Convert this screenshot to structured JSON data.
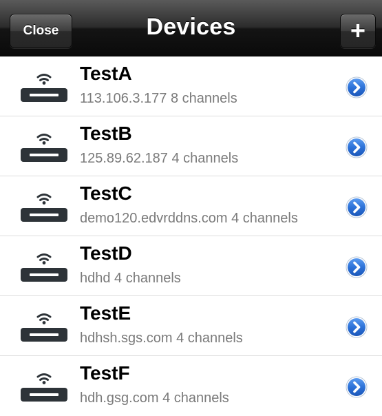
{
  "navbar": {
    "title": "Devices",
    "close_label": "Close",
    "add_label": "+"
  },
  "devices": [
    {
      "name": "TestA",
      "detail": "113.106.3.177 8 channels"
    },
    {
      "name": "TestB",
      "detail": "125.89.62.187 4 channels"
    },
    {
      "name": "TestC",
      "detail": "demo120.edvrddns.com 4 channels"
    },
    {
      "name": "TestD",
      "detail": "hdhd 4 channels"
    },
    {
      "name": "TestE",
      "detail": "hdhsh.sgs.com 4 channels"
    },
    {
      "name": "TestF",
      "detail": "hdh.gsg.com 4 channels"
    }
  ],
  "icons": {
    "device": "dvr-wifi-icon",
    "disclosure": "detail-disclosure-icon"
  },
  "colors": {
    "navbar": "#1a1a1a",
    "detail_text": "#7a7a7a",
    "disclosure_blue": "#2c6fd6",
    "separator": "#dcdcdc"
  }
}
